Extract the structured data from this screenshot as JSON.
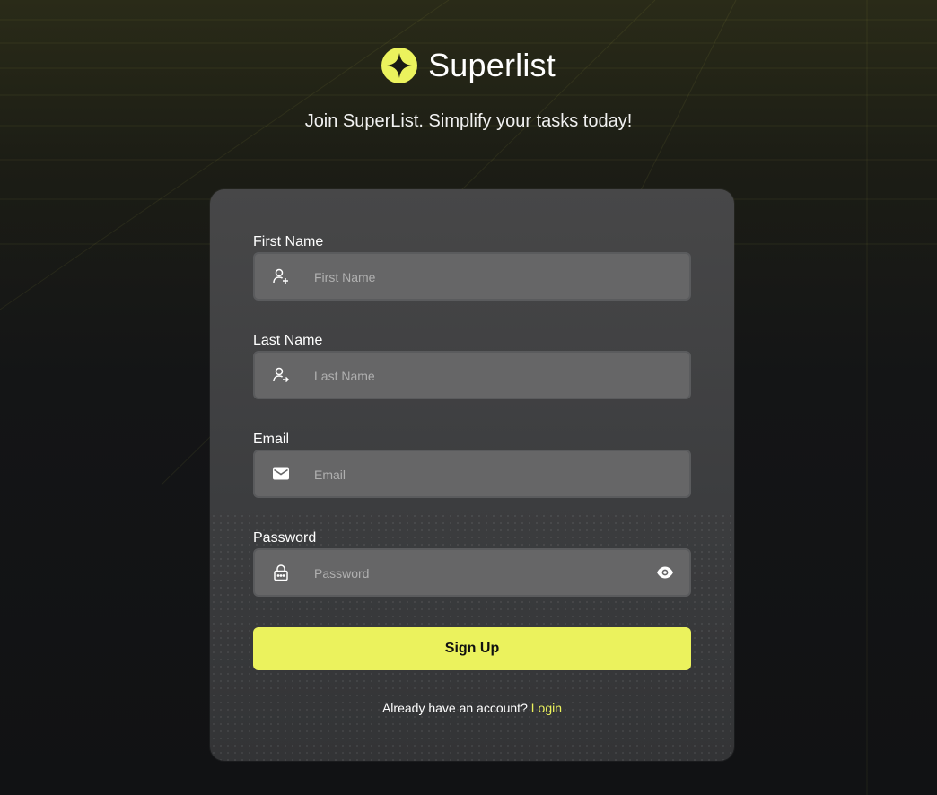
{
  "brand": {
    "name": "Superlist",
    "logo_icon": "sparkle-star-icon",
    "accent": "#ebf25d"
  },
  "tagline": "Join SuperList. Simplify your tasks today!",
  "form": {
    "first_name": {
      "label": "First Name",
      "placeholder": "First Name",
      "value": "",
      "icon": "user-add-icon"
    },
    "last_name": {
      "label": "Last Name",
      "placeholder": "Last Name",
      "value": "",
      "icon": "user-arrow-icon"
    },
    "email": {
      "label": "Email",
      "placeholder": "Email",
      "value": "",
      "icon": "mail-icon"
    },
    "password": {
      "label": "Password",
      "placeholder": "Password",
      "value": "",
      "icon": "lock-icon",
      "toggle_icon": "eye-icon"
    },
    "submit_label": "Sign Up"
  },
  "footer": {
    "prompt": "Already have an account?",
    "link_label": "Login"
  }
}
